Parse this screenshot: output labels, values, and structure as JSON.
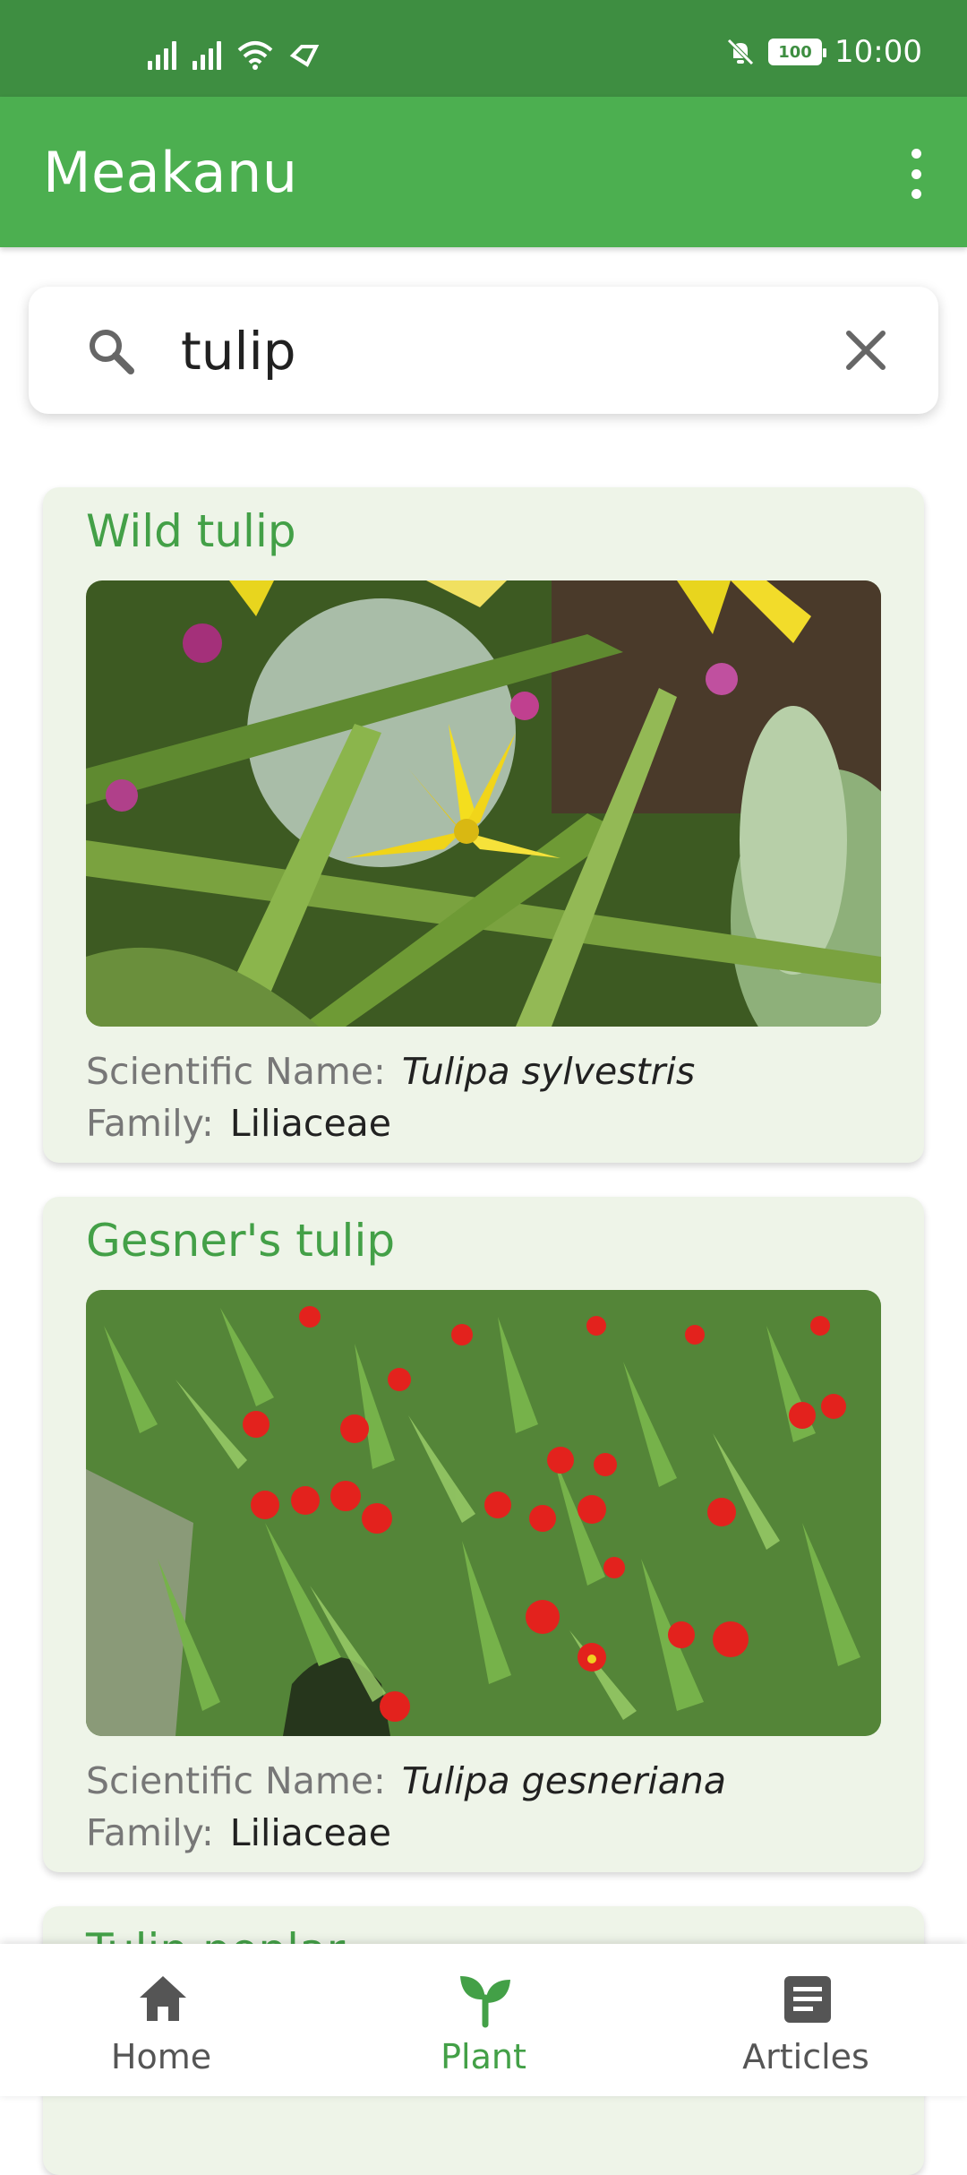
{
  "status_bar": {
    "time": "10:00",
    "battery": "100"
  },
  "app_bar": {
    "title": "Meakanu"
  },
  "search": {
    "value": "tulip",
    "placeholder": ""
  },
  "cards": [
    {
      "name": "Wild tulip",
      "scientific_label": "Scientific Name:",
      "scientific_name": "Tulipa sylvestris",
      "family_label": "Family:",
      "family": "Liliaceae"
    },
    {
      "name": "Gesner's tulip",
      "scientific_label": "Scientific Name:",
      "scientific_name": "Tulipa gesneriana",
      "family_label": "Family:",
      "family": "Liliaceae"
    },
    {
      "name": "Tulip poplar"
    }
  ],
  "bottom_nav": {
    "items": [
      {
        "label": "Home",
        "icon": "home-icon",
        "active": false
      },
      {
        "label": "Plant",
        "icon": "sprout-icon",
        "active": true
      },
      {
        "label": "Articles",
        "icon": "article-icon",
        "active": false
      }
    ]
  },
  "colors": {
    "status_bar": "#3e8e41",
    "app_bar": "#4caf50",
    "accent": "#43a047",
    "card_bg": "#eef4e8"
  }
}
